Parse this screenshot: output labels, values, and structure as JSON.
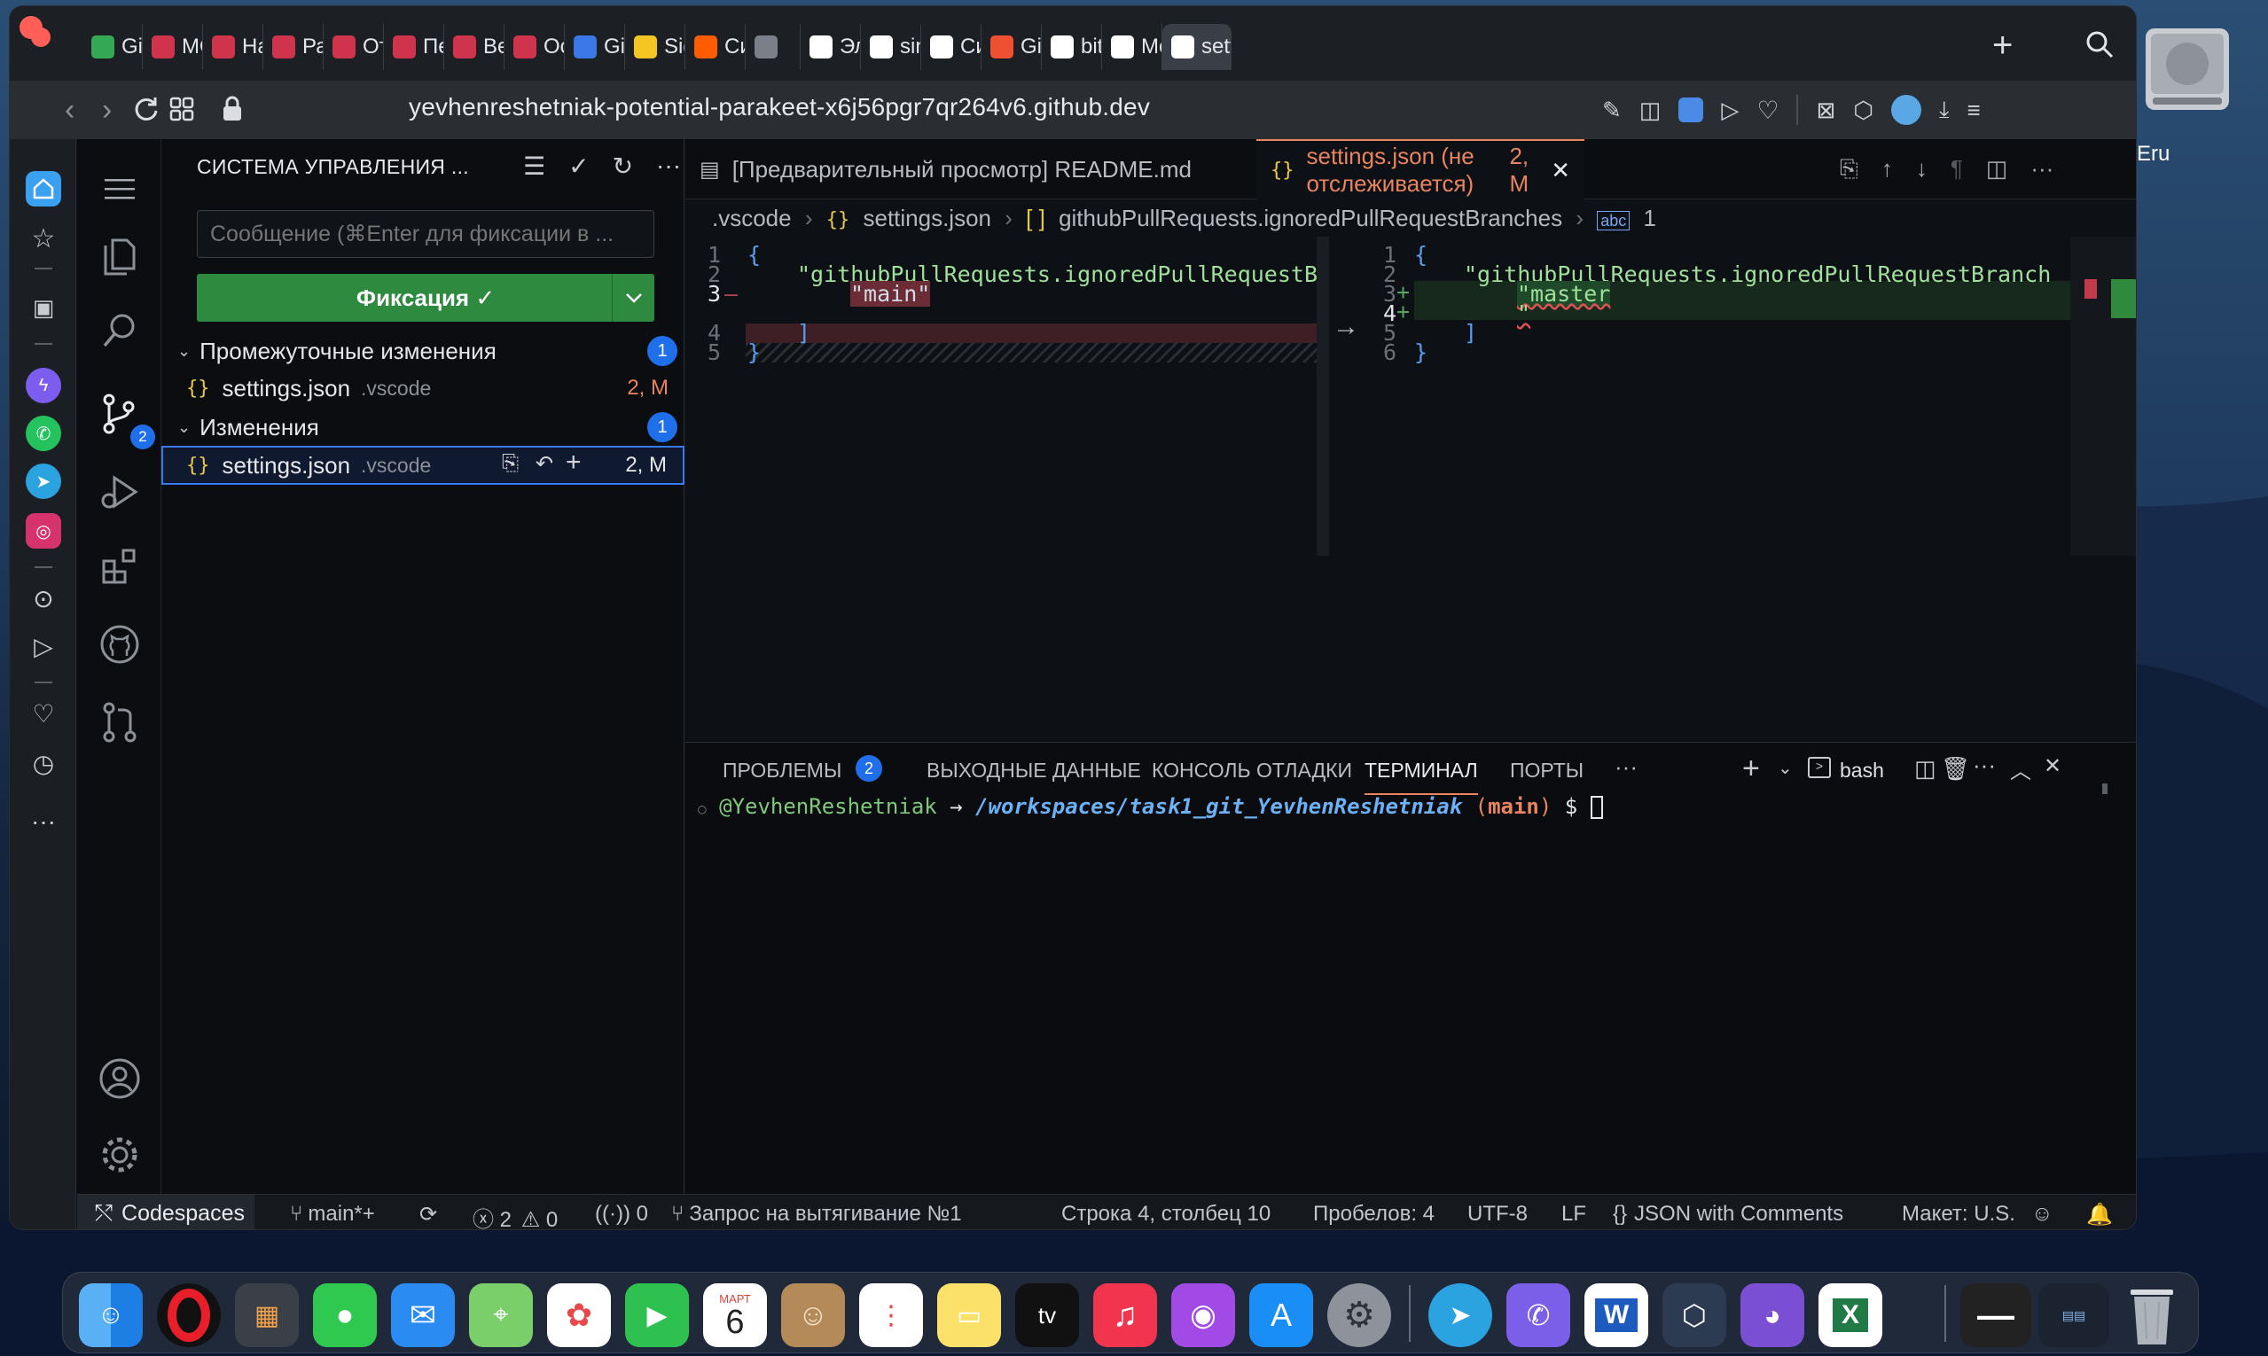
{
  "browser": {
    "tabs": [
      {
        "label": "Git_",
        "icon": "google-drive-icon",
        "color": "#34a853"
      },
      {
        "label": "MOL",
        "icon": "codecademy-icon",
        "color": "#d0344c"
      },
      {
        "label": "Нач",
        "icon": "codecademy-icon",
        "color": "#d0344c"
      },
      {
        "label": "Раб",
        "icon": "codecademy-icon",
        "color": "#d0344c"
      },
      {
        "label": "Отм",
        "icon": "codecademy-icon",
        "color": "#d0344c"
      },
      {
        "label": "Пер",
        "icon": "codecademy-icon",
        "color": "#d0344c"
      },
      {
        "label": "Вет",
        "icon": "codecademy-icon",
        "color": "#d0344c"
      },
      {
        "label": "Осн",
        "icon": "codecademy-icon",
        "color": "#d0344c"
      },
      {
        "label": "Git_",
        "icon": "google-docs-icon",
        "color": "#3b78e7"
      },
      {
        "label": "Sign",
        "icon": "miro-icon",
        "color": "#f5c623"
      },
      {
        "label": "Сим",
        "icon": "kinopoisk-icon",
        "color": "#ff5b00"
      },
      {
        "label": "",
        "icon": "audio-tab-icon",
        "color": "#7a7f88"
      },
      {
        "label": "Эле",
        "icon": "google-icon",
        "color": "#ffffff"
      },
      {
        "label": "sing",
        "icon": "google-icon",
        "color": "#ffffff"
      },
      {
        "label": "Син",
        "icon": "wikipedia-icon",
        "color": "#ffffff"
      },
      {
        "label": "Git -",
        "icon": "git-icon",
        "color": "#f05032"
      },
      {
        "label": "bitb",
        "icon": "google-icon",
        "color": "#ffffff"
      },
      {
        "label": "Mer",
        "icon": "github-icon",
        "color": "#ffffff"
      },
      {
        "label": "settin",
        "icon": "github-icon",
        "color": "#ffffff"
      }
    ],
    "url": "yevhenreshetniak-potential-parakeet-x6j56pgr7qr264v6.github.dev"
  },
  "desktop": {
    "hdd_label": "Eru"
  },
  "vscode": {
    "sidebar": {
      "title": "СИСТЕМА УПРАВЛЕНИЯ ...",
      "commit_placeholder": "Сообщение (⌘Enter для фиксации в ...",
      "commit_button": "Фиксация ✓",
      "staged_header": "Промежуточные изменения",
      "staged_count": "1",
      "changes_header": "Изменения",
      "changes_count": "1",
      "staged_file": {
        "name": "settings.json",
        "dir": ".vscode",
        "status": "2, M"
      },
      "changed_file": {
        "name": "settings.json",
        "dir": ".vscode",
        "status": "2, M"
      }
    },
    "scm_badge": "2",
    "editor_tabs": [
      {
        "label": "[Предварительный просмотр] README.md",
        "active": false
      },
      {
        "label": "settings.json (не отслеживается)",
        "status": "2, M",
        "active": true
      }
    ],
    "breadcrumb": {
      "folder": ".vscode",
      "file": "settings.json",
      "key": "githubPullRequests.ignoredPullRequestBranches",
      "item": "1"
    },
    "diff_left": {
      "line_numbers": [
        "1",
        "2",
        "3",
        "",
        "4",
        "5"
      ],
      "lines": [
        "{",
        "\"githubPullRequests.ignoredPullRequestBranch",
        "\"main\"",
        "",
        "]",
        "}"
      ]
    },
    "diff_right": {
      "line_numbers": [
        "1",
        "2",
        "3",
        "4",
        "5",
        "6"
      ],
      "lines": [
        "{",
        "\"githubPullRequests.ignoredPullRequestBranch",
        "\"master",
        "\"",
        "]",
        "}"
      ]
    },
    "panel_tabs": [
      "ПРОБЛЕМЫ",
      "ВЫХОДНЫЕ ДАННЫЕ",
      "КОНСОЛЬ ОТЛАДКИ",
      "ТЕРМИНАЛ",
      "ПОРТЫ"
    ],
    "problems_count": "2",
    "shell": "bash",
    "terminal": {
      "user": "@YevhenReshetniak",
      "arrow": "→",
      "path": "/workspaces/task1_git_YevhenReshetniak",
      "branch_open": "(",
      "branch": "main",
      "branch_close": ")",
      "prompt": "$"
    },
    "status": {
      "remote": "Codespaces",
      "branch": "main*+",
      "errors": "2",
      "warnings": "0",
      "ports": "0",
      "pr": "Запрос на вытягивание №1",
      "cursor": "Строка 4, столбец 10",
      "indent": "Пробелов: 4",
      "encoding": "UTF-8",
      "eol": "LF",
      "language": "JSON with Comments",
      "layout": "Макет: U.S."
    }
  },
  "dock": {
    "calendar_month": "МАРТ",
    "calendar_day": "6",
    "tv_label": "tv"
  }
}
